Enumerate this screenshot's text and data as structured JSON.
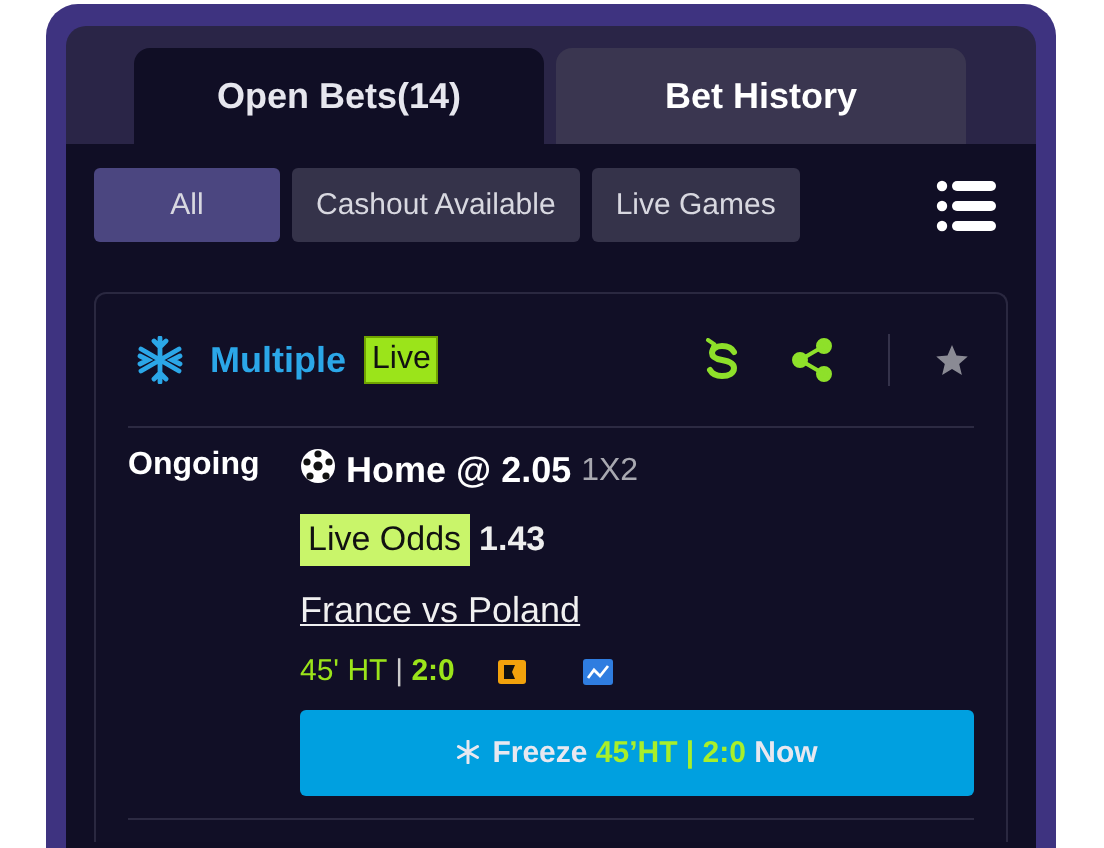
{
  "tabs": [
    {
      "label": "Open Bets(14)",
      "selected": true
    },
    {
      "label": "Bet History",
      "selected": false
    }
  ],
  "filters": [
    {
      "label": "All",
      "selected": true
    },
    {
      "label": "Cashout Available",
      "selected": false
    },
    {
      "label": "Live Games",
      "selected": false
    }
  ],
  "bet": {
    "type": "Multiple",
    "live_badge": "Live",
    "status": "Ongoing",
    "selection": "Home @ 2.05",
    "market": "1X2",
    "live_odds_label": "Live Odds",
    "live_odds": "1.43",
    "match": "France vs Poland",
    "match_time": "45' HT",
    "separator": "|",
    "score": "2:0",
    "freeze_button": {
      "label": "Freeze",
      "time": "45’HT | 2:0",
      "suffix": "Now"
    }
  }
}
